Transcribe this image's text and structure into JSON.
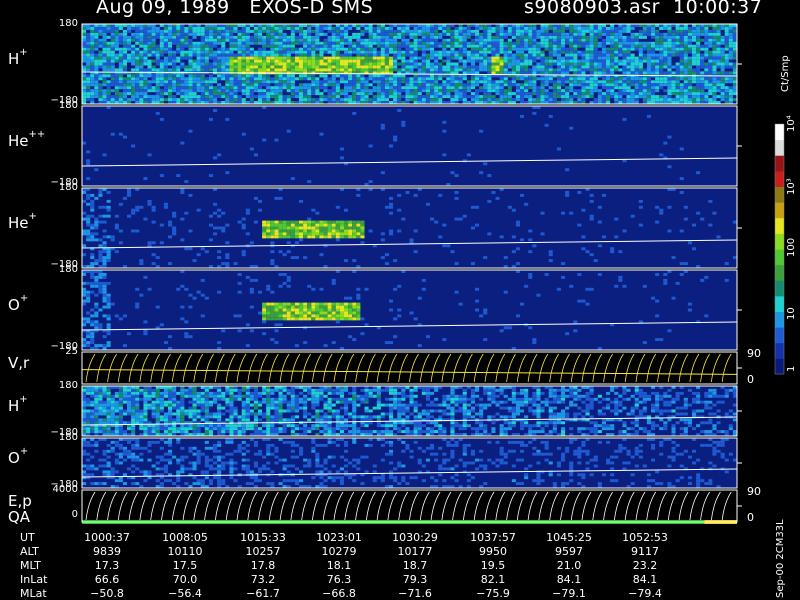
{
  "header": {
    "title": "Aug 09, 1989   EXOS-D SMS",
    "file": "s9080903.asr  10:00:37"
  },
  "colors": {
    "background": "#000000",
    "panel_base": "#0a1f80",
    "line": "#ffffff",
    "yellow": "#f5e642",
    "qa_green": "#28c828",
    "qa_yellow": "#f0d020"
  },
  "colorbar": {
    "unit": "Ct/Smp",
    "ticks": [
      "1",
      "10",
      "100",
      "10³",
      "10⁴"
    ],
    "colors": [
      "#0a1a78",
      "#1433a8",
      "#1e5ad2",
      "#1e96e6",
      "#1ed2d2",
      "#148c6e",
      "#3ca03c",
      "#50c832",
      "#8cdc1e",
      "#e6e61e",
      "#c8a014",
      "#8c7814",
      "#c81e1e",
      "#961414",
      "#dcdcdc",
      "#ffffff"
    ]
  },
  "chart_data": [
    {
      "type": "heatmap",
      "panel": "H+ pitch angle spectrogram",
      "label": "H",
      "label_sup": "+",
      "ylim": [
        -180,
        180
      ],
      "ytick_top": "180",
      "ytick_bottom": "−180",
      "density": 0.9,
      "hotspots": [
        [
          0.22,
          0.35
        ],
        [
          0.35,
          0.47
        ],
        [
          0.62,
          0.64
        ]
      ]
    },
    {
      "type": "heatmap",
      "panel": "He++ pitch angle spectrogram",
      "label": "He",
      "label_sup": "++",
      "ylim": [
        -180,
        180
      ],
      "ytick_top": "180",
      "ytick_bottom": "−180",
      "density": 0.02,
      "hotspots": []
    },
    {
      "type": "heatmap",
      "panel": "He+ pitch angle spectrogram",
      "label": "He",
      "label_sup": "+",
      "ylim": [
        -180,
        180
      ],
      "ytick_top": "180",
      "ytick_bottom": "−180",
      "density": 0.1,
      "hotspots": [
        [
          0.27,
          0.43
        ]
      ]
    },
    {
      "type": "heatmap",
      "panel": "O+ pitch angle spectrogram",
      "label": "O",
      "label_sup": "+",
      "ylim": [
        -180,
        180
      ],
      "ytick_top": "180",
      "ytick_bottom": "−180",
      "density": 0.06,
      "hotspots": [
        [
          0.27,
          0.42
        ]
      ]
    },
    {
      "type": "line",
      "panel": "V,r sweep",
      "label": "V,r",
      "ytick_top": "25",
      "right_ticks": [
        "90",
        "0"
      ]
    },
    {
      "type": "heatmap",
      "panel": "H+ energy spectrogram",
      "label": "H",
      "label_sup": "+",
      "ylim": [
        -180,
        180
      ],
      "ytick_top": "180",
      "ytick_bottom": "−180",
      "density": 0.8,
      "hotspots": []
    },
    {
      "type": "heatmap",
      "panel": "O+ energy spectrogram",
      "label": "O",
      "label_sup": "+",
      "ylim": [
        -180,
        180
      ],
      "ytick_top": "180",
      "ytick_bottom": "−180",
      "density": 0.35,
      "hotspots": []
    },
    {
      "type": "line",
      "panel": "E,p / QA",
      "label": "E,p",
      "label2": "QA",
      "ytick_top": "4000",
      "ytick_bottom": "0",
      "right_ticks": [
        "90",
        "0"
      ]
    }
  ],
  "table": {
    "rows": [
      {
        "label": "UT",
        "values": [
          "1000:37",
          "1008:05",
          "1015:33",
          "1023:01",
          "1030:29",
          "1037:57",
          "1045:25",
          "1052:53"
        ]
      },
      {
        "label": "ALT",
        "values": [
          "9839",
          "10110",
          "10257",
          "10279",
          "10177",
          "9950",
          "9597",
          "9117"
        ]
      },
      {
        "label": "MLT",
        "values": [
          "17.3",
          "17.5",
          "17.8",
          "18.1",
          "18.7",
          "19.5",
          "21.0",
          "23.2"
        ]
      },
      {
        "label": "InLat",
        "values": [
          "66.6",
          "70.0",
          "73.2",
          "76.3",
          "79.3",
          "82.1",
          "84.1",
          "84.1"
        ]
      },
      {
        "label": "MLat",
        "values": [
          "−50.8",
          "−56.4",
          "−61.7",
          "−66.8",
          "−71.6",
          "−75.9",
          "−79.1",
          "−79.4"
        ]
      }
    ]
  },
  "side_label": "Sep-00  2CM33L"
}
